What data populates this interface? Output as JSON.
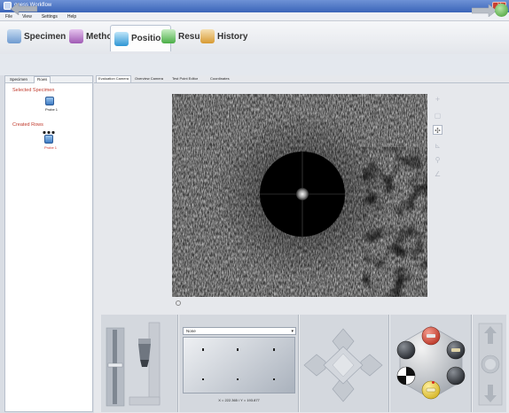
{
  "window": {
    "title": "qness Workflow",
    "close_label": "✕"
  },
  "menu": [
    "File",
    "View",
    "Settings",
    "Help"
  ],
  "main_tabs": [
    {
      "label": "Specimen",
      "color": "#7aa6d6"
    },
    {
      "label": "Method",
      "color": "#b270c0"
    },
    {
      "label": "Position",
      "color": "#3fa9df",
      "active": true
    },
    {
      "label": "Result",
      "color": "#5ec05a"
    },
    {
      "label": "History",
      "color": "#e2b04a"
    }
  ],
  "left_panel": {
    "tabs": [
      "Specimen",
      "Rows"
    ],
    "active_tab": "Rows",
    "selected_specimen_title": "Selected Specimen",
    "selected_specimen_label": "Probe 1",
    "created_rows_title": "Created Rows",
    "created_row_label": "Probe 1"
  },
  "content_tabs": [
    "Evaluation Camera",
    "Overview Camera",
    "Test Point Editor",
    "Coordinates"
  ],
  "active_content_tab": "Evaluation Camera",
  "image_tools": [
    "crosshair-tool",
    "rectangle-tool",
    "move-tool",
    "measure-tool",
    "zoom-tool",
    "angle-tool"
  ],
  "stage": {
    "dropdown_value": "None",
    "dropdown_arrow": "▾",
    "coordinates": "X = 222.365 / Y = 193.877"
  },
  "controls": {
    "led_color": "#d62b1f"
  }
}
